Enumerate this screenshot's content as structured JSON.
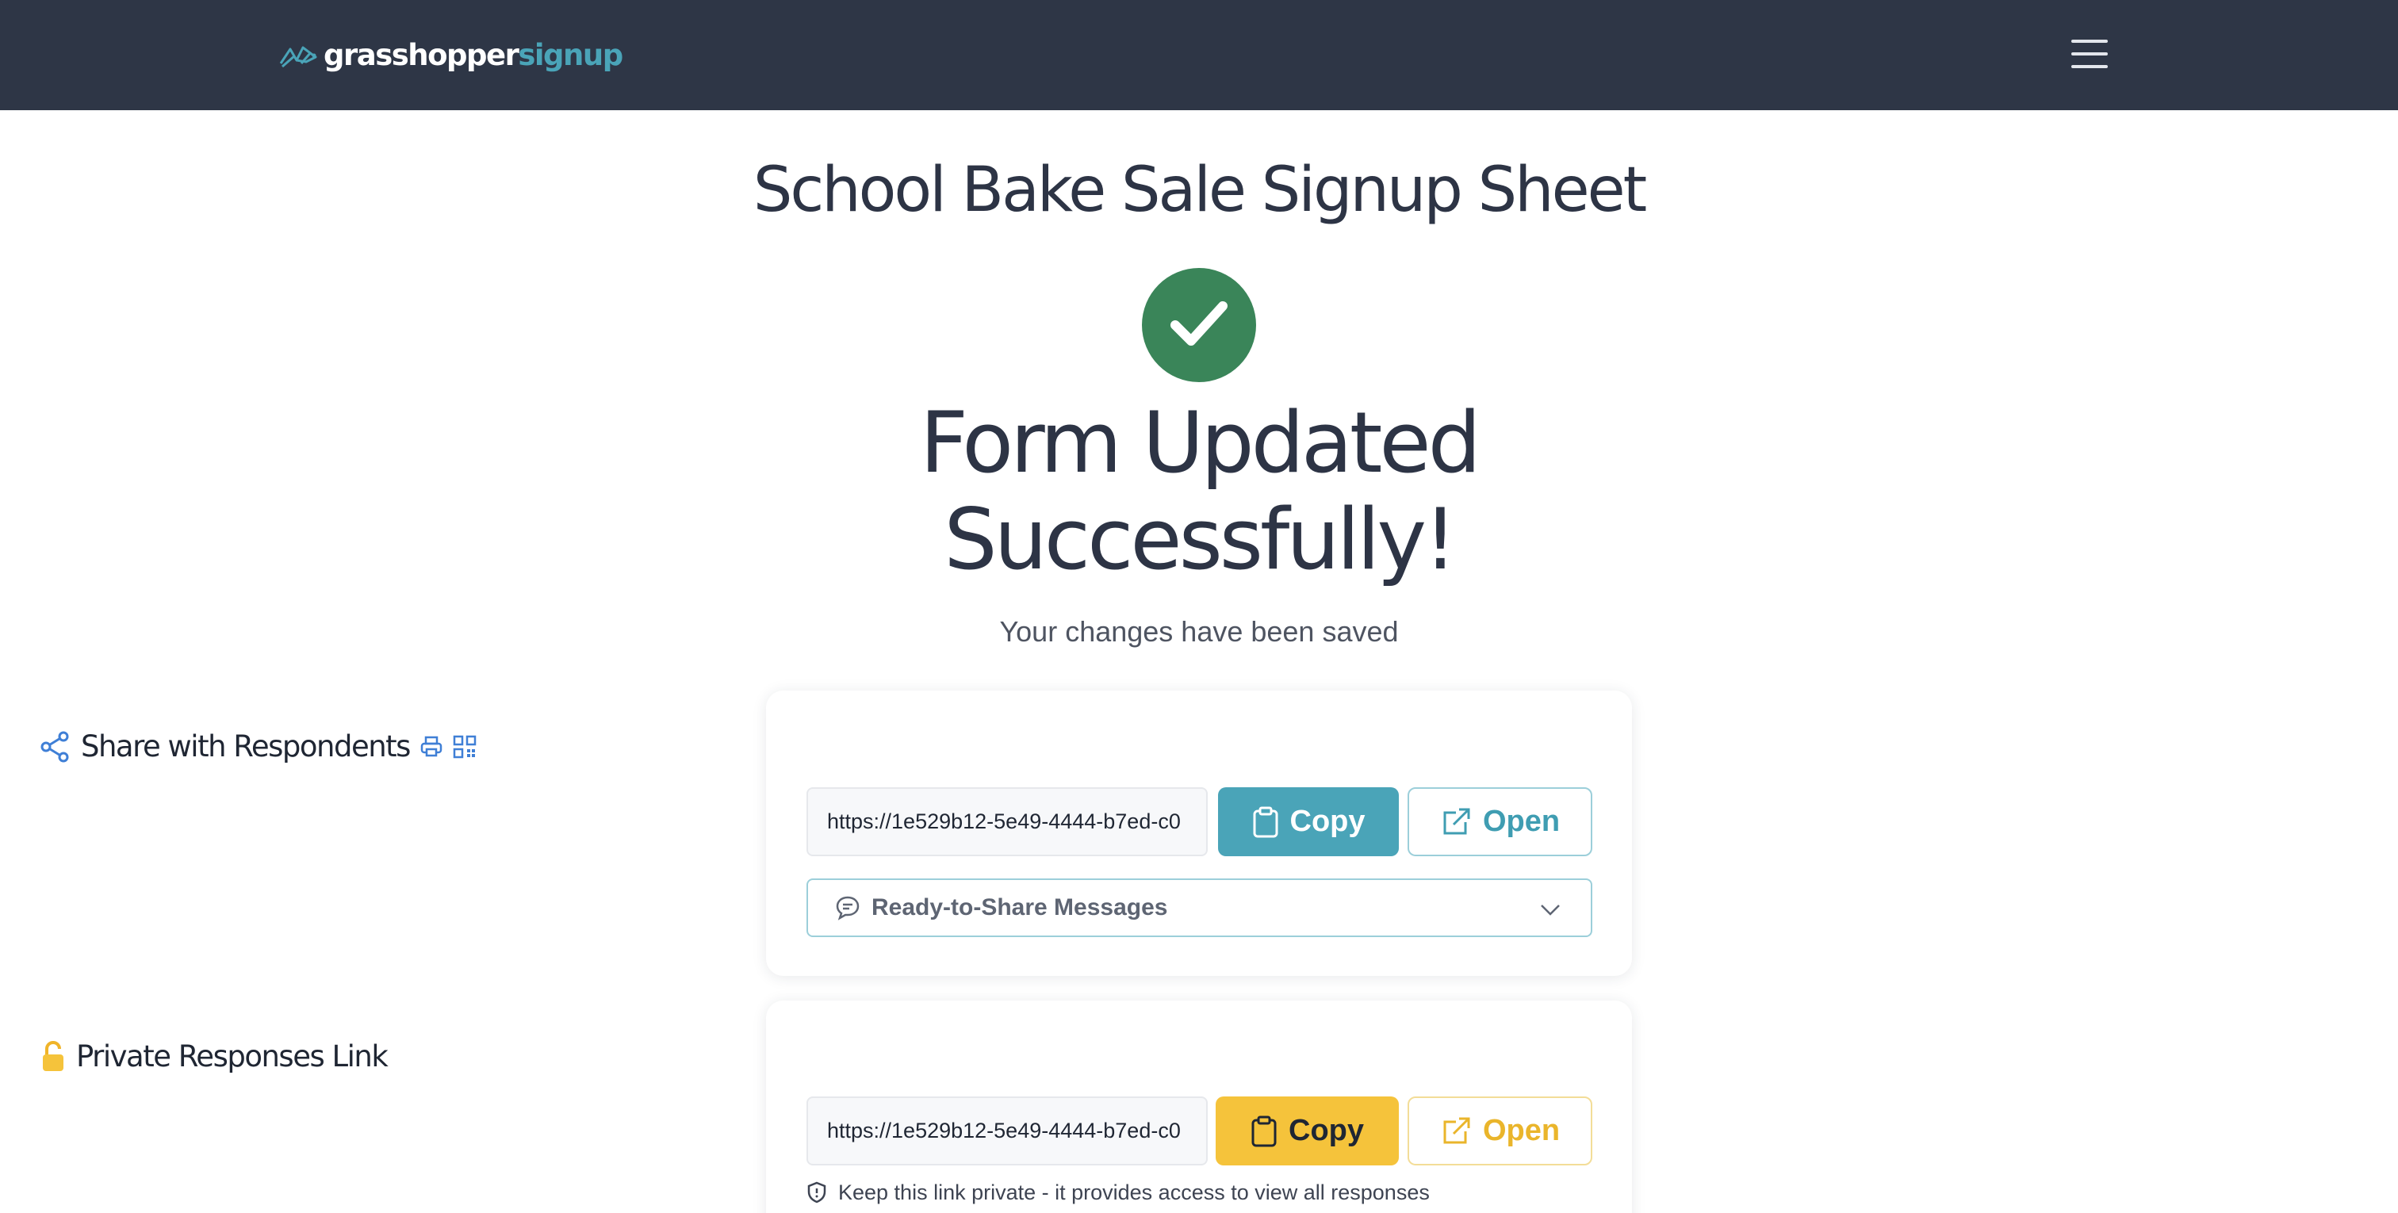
{
  "header": {
    "logo_part1": "grasshopper",
    "logo_part2": "signup",
    "menu_icon": "hamburger-menu-icon",
    "colors": {
      "bar": "#2e3646",
      "accent": "#4aa4b8"
    }
  },
  "page": {
    "title": "School Bake Sale Signup Sheet",
    "status_icon": "check-circle-icon",
    "headline_line1": "Form Updated",
    "headline_line2": "Successfully!",
    "subline": "Your changes have been saved",
    "success_color": "#3a8559"
  },
  "share_card": {
    "icon": "share-icon",
    "title": "Share with Respondents",
    "extra_icons": [
      "printer-icon",
      "qr-code-icon"
    ],
    "url": "https://1e529b12-5e49-4444-b7ed-c0",
    "copy_label": "Copy",
    "open_label": "Open",
    "messages_label": "Ready-to-Share Messages",
    "messages_icon": "chat-bubble-icon",
    "accent": "#4aa4b8"
  },
  "private_card": {
    "icon": "lock-icon",
    "title": "Private Responses Link",
    "url": "https://1e529b12-5e49-4444-b7ed-c0",
    "copy_label": "Copy",
    "open_label": "Open",
    "note_icon": "shield-icon",
    "note": "Keep this link private - it provides access to view all responses",
    "accent": "#f5c33b"
  }
}
